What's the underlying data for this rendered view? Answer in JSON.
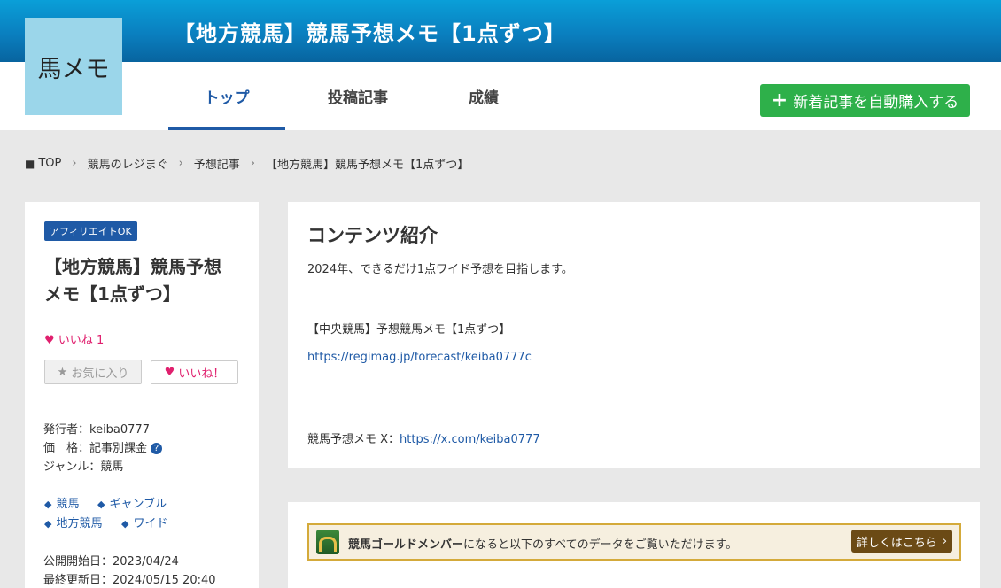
{
  "header": {
    "logo_text": "馬メモ",
    "site_title": "【地方競馬】競馬予想メモ【1点ずつ】"
  },
  "nav": {
    "tabs": [
      {
        "label": "トップ",
        "active": true
      },
      {
        "label": "投稿記事",
        "active": false
      },
      {
        "label": "成績",
        "active": false
      }
    ],
    "buy_button": "新着記事を自動購入する"
  },
  "breadcrumb": [
    "TOP",
    "競馬のレジまぐ",
    "予想記事",
    "【地方競馬】競馬予想メモ【1点ずつ】"
  ],
  "sidebar": {
    "badge": "アフィリエイトOK",
    "title_line1": "【地方競馬】競馬予想",
    "title_line2": "メモ【1点ずつ】",
    "like_label": "いいね",
    "like_count": "1",
    "fav_button": "お気に入り",
    "like_button": "いいね！",
    "publisher": "発行者：keiba0777",
    "price": "価　格：記事別課金",
    "genre": "ジャンル：競馬",
    "tags": [
      "競馬",
      "ギャンブル",
      "地方競馬",
      "ワイド"
    ],
    "start_date": "公開開始日：2023/04/24",
    "updated": "最終更新日：2024/05/15 20:40"
  },
  "content": {
    "title": "コンテンツ紹介",
    "intro": "2024年、できるだけ1点ワイド予想を目指します。",
    "related_title": "【中央競馬】予想競馬メモ【1点ずつ】",
    "related_url": "https://regimag.jp/forecast/keiba0777c",
    "x_label": "競馬予想メモ X：",
    "x_url": "https://x.com/keiba0777"
  },
  "gold": {
    "strong": "競馬ゴールドメンバー",
    "text": "になると以下のすべてのデータをご覧いただけます。",
    "button": "詳しくはこちら"
  },
  "colors": {
    "header_blue": "#0a7fbf",
    "accent_blue": "#1f5aa6",
    "buy_green": "#2eb04a",
    "like_pink": "#e0206e",
    "gold_border": "#d4aa3a"
  }
}
